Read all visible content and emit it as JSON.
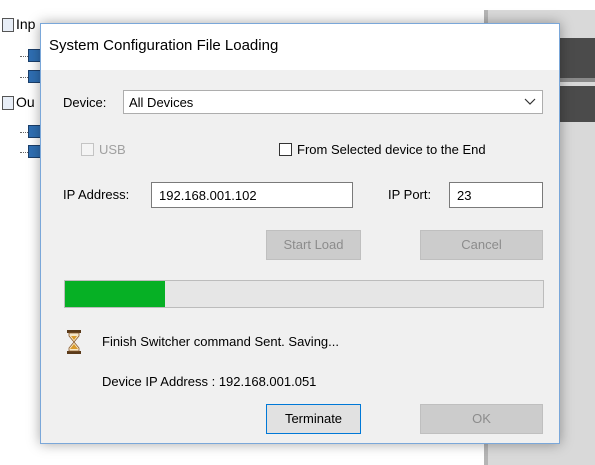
{
  "background": {
    "tree": {
      "input_label": "Inp",
      "output_label": "Ou"
    }
  },
  "dialog": {
    "title": "System Configuration File Loading",
    "device_label": "Device:",
    "device_value": "All Devices",
    "usb_label": "USB",
    "from_selected_label": "From Selected device to the End",
    "ip_address_label": "IP Address:",
    "ip_address_value": "192.168.001.102",
    "ip_port_label": "IP Port:",
    "ip_port_value": "23",
    "start_load_label": "Start Load",
    "cancel_label": "Cancel",
    "progress_fraction": 0.21,
    "status_text": "Finish Switcher command Sent. Saving...",
    "device_ip_text": "Device IP Address : 192.168.001.051",
    "terminate_label": "Terminate",
    "ok_label": "OK"
  },
  "colors": {
    "progress_fill": "#06b025",
    "dialog_border": "#7aa7d9",
    "primary_button_border": "#0078d7"
  },
  "icons": {
    "dropdown": "chevron-down-icon",
    "status": "hourglass-icon"
  }
}
